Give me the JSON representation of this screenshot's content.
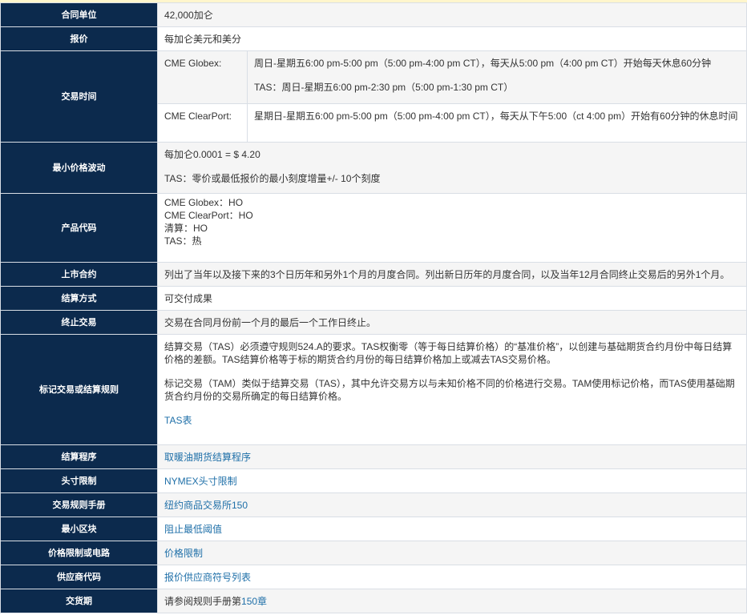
{
  "rows": {
    "unit": {
      "label": "合同单位",
      "value": "42,000加仑"
    },
    "quote": {
      "label": "报价",
      "value": "每加仑美元和美分"
    },
    "hours": {
      "label": "交易时间",
      "globex_label": "CME Globex:",
      "globex_line1": "周日-星期五6:00 pm-5:00 pm（5:00 pm-4:00 pm CT），每天从5:00 pm（4:00 pm CT）开始每天休息60分钟",
      "globex_line2": "TAS：周日-星期五6:00 pm-2:30 pm（5:00 pm-1:30 pm CT）",
      "clearport_label": "CME ClearPort:",
      "clearport_line": "星期日-星期五6:00 pm-5:00 pm（5:00 pm-4:00 pm CT），每天从下午5:00（ct 4:00 pm）开始有60分钟的休息时间"
    },
    "tick": {
      "label": "最小价格波动",
      "line1": "每加仑0.0001 = $ 4.20",
      "line2": "TAS：零价或最低报价的最小刻度增量+/- 10个刻度"
    },
    "code": {
      "label": "产品代码",
      "line1": "CME Globex：HO",
      "line2": "CME ClearPort：HO",
      "line3": "清算：HO",
      "line4": "TAS：热"
    },
    "listed": {
      "label": "上市合约",
      "value": "列出了当年以及接下来的3个日历年和另外1个月的月度合同。列出新日历年的月度合同，以及当年12月合同终止交易后的另外1个月。"
    },
    "settle_method": {
      "label": "结算方式",
      "value": "可交付成果"
    },
    "terminate": {
      "label": "终止交易",
      "value": "交易在合同月份前一个月的最后一个工作日终止。"
    },
    "tas_rules": {
      "label": "标记交易或结算规则",
      "para1": "结算交易（TAS）必须遵守规则524.A的要求。TAS权衡零（等于每日结算价格）的“基准价格”，以创建与基础期货合约月份中每日结算价格的差额。TAS结算价格等于标的期货合约月份的每日结算价格加上或减去TAS交易价格。",
      "para2": "标记交易（TAM）类似于结算交易（TAS），其中允许交易方以与未知价格不同的价格进行交易。TAM使用标记价格，而TAS使用基础期货合约月份的交易所确定的每日结算价格。",
      "link": "TAS表"
    },
    "settle_proc": {
      "label": "结算程序",
      "link": "取暖油期货结算程序"
    },
    "position": {
      "label": "头寸限制",
      "link": "NYMEX头寸限制"
    },
    "rulebook": {
      "label": "交易规则手册",
      "link": "纽约商品交易所150"
    },
    "block": {
      "label": "最小区块",
      "link": "阻止最低阈值"
    },
    "limits": {
      "label": "价格限制或电路",
      "link": "价格限制"
    },
    "vendor": {
      "label": "供应商代码",
      "link": "报价供应商符号列表"
    },
    "delivery": {
      "label": "交货期",
      "value": "请参阅规则手册第",
      "link": "150章"
    }
  }
}
